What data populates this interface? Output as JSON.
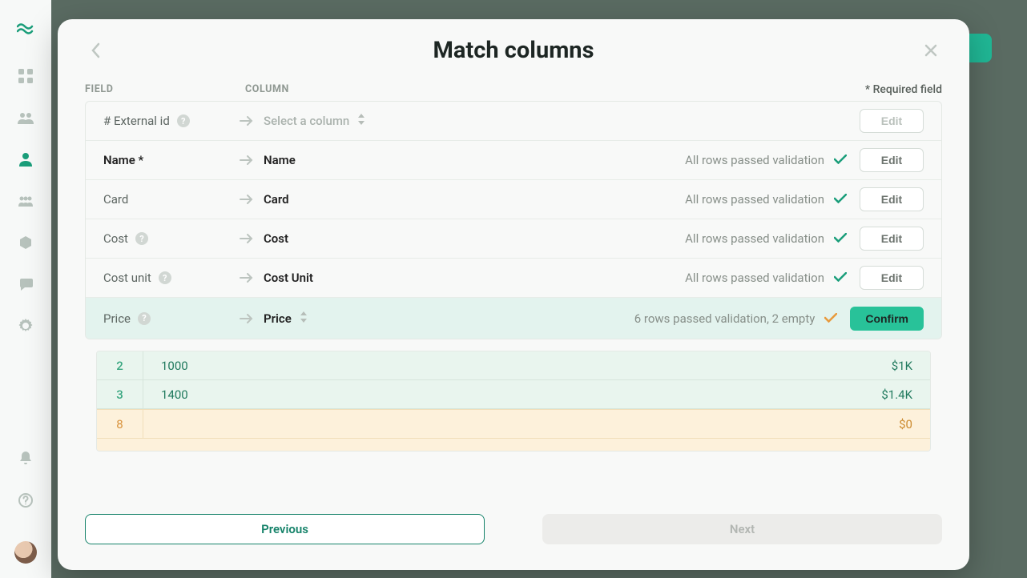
{
  "modal": {
    "title": "Match columns",
    "headers": {
      "field": "FIELD",
      "column": "COLUMN",
      "required": "* Required field"
    },
    "rows": [
      {
        "field": "# External id",
        "column": "Select a column",
        "validation": "",
        "button": "Edit"
      },
      {
        "field": "Name *",
        "column": "Name",
        "validation": "All rows passed validation",
        "button": "Edit"
      },
      {
        "field": "Card",
        "column": "Card",
        "validation": "All rows passed validation",
        "button": "Edit"
      },
      {
        "field": "Cost",
        "column": "Cost",
        "validation": "All rows passed validation",
        "button": "Edit"
      },
      {
        "field": "Cost unit",
        "column": "Cost Unit",
        "validation": "All rows passed validation",
        "button": "Edit"
      },
      {
        "field": "Price",
        "column": "Price",
        "validation": "6 rows passed validation, 2 empty",
        "button": "Confirm"
      }
    ],
    "preview": [
      {
        "num": "2",
        "value": "1000",
        "formatted": "$1K"
      },
      {
        "num": "3",
        "value": "1400",
        "formatted": "$1.4K"
      },
      {
        "num": "8",
        "value": "",
        "formatted": "$0"
      }
    ],
    "footer": {
      "prev": "Previous",
      "next": "Next"
    }
  }
}
